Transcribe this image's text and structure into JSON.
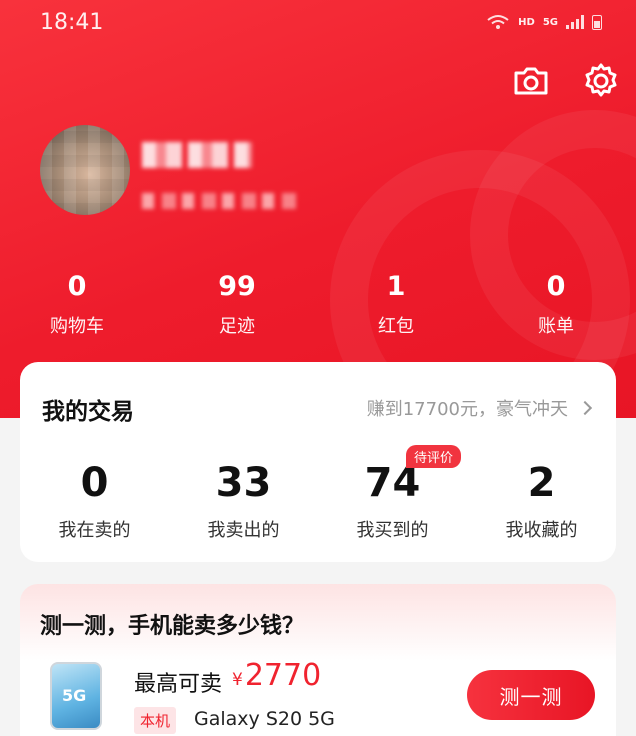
{
  "status_bar": {
    "time": "18:41",
    "network_label": "HD",
    "cell_label": "5G"
  },
  "colors": {
    "brand_red": "#ee1c2c",
    "price_red": "#f0232f"
  },
  "header": {
    "camera_icon": "camera-icon",
    "settings_icon": "gear-icon"
  },
  "profile": {
    "avatar": "avatar-pixelated",
    "name": "",
    "subtitle": ""
  },
  "stats": [
    {
      "value": "0",
      "label": "购物车"
    },
    {
      "value": "99",
      "label": "足迹"
    },
    {
      "value": "1",
      "label": "红包"
    },
    {
      "value": "0",
      "label": "账单"
    }
  ],
  "trade": {
    "title": "我的交易",
    "summary": "赚到17700元，豪气冲天",
    "items": [
      {
        "value": "0",
        "label": "我在卖的"
      },
      {
        "value": "33",
        "label": "我卖出的"
      },
      {
        "value": "74",
        "label": "我买到的",
        "badge": "待评价"
      },
      {
        "value": "2",
        "label": "我收藏的"
      }
    ]
  },
  "estimate": {
    "title": "测一测，手机能卖多少钱？",
    "phone_icon_text": "5G",
    "price_label": "最高可卖",
    "currency": "¥",
    "price": "2770",
    "tag": "本机",
    "model": "Galaxy S20 5G",
    "button": "测一测"
  }
}
